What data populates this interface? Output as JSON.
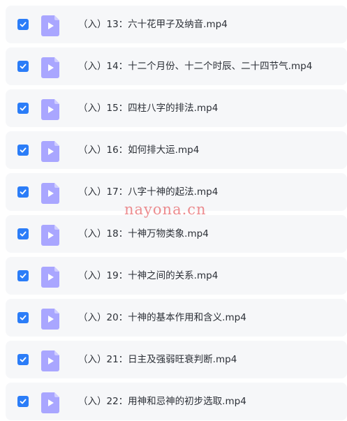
{
  "files": [
    {
      "name": "（入）13：六十花甲子及纳音.mp4",
      "checked": true
    },
    {
      "name": "（入）14：十二个月份、十二个时辰、二十四节气.mp4",
      "checked": true
    },
    {
      "name": "（入）15：四柱八字的排法.mp4",
      "checked": true
    },
    {
      "name": "（入）16：如何排大运.mp4",
      "checked": true
    },
    {
      "name": "（入）17：八字十神的起法.mp4",
      "checked": true
    },
    {
      "name": "（入）18：十神万物类象.mp4",
      "checked": true
    },
    {
      "name": "（入）19：十神之间的关系.mp4",
      "checked": true
    },
    {
      "name": "（入）20：十神的基本作用和含义.mp4",
      "checked": true
    },
    {
      "name": "（入）21：日主及强弱旺衰判断.mp4",
      "checked": true
    },
    {
      "name": "（入）22：用神和忌神的初步选取.mp4",
      "checked": true
    }
  ],
  "watermark": "nayona.cn",
  "icons": {
    "checkbox": "checkmark-icon",
    "file": "video-file-icon"
  },
  "colors": {
    "checkbox": "#2b7df8",
    "file_icon": "#a9a6ff",
    "row_background": "#f6f7f9",
    "watermark": "#e8666a"
  }
}
